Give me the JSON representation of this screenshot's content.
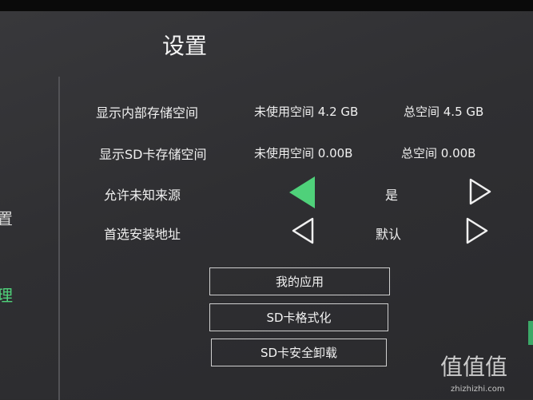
{
  "page": {
    "title": "设置"
  },
  "sidebar": {
    "partial_a": "置",
    "partial_b": "理"
  },
  "storage": {
    "internal": {
      "label": "显示内部存储空间",
      "free": "未使用空间 4.2 GB",
      "total": "总空间 4.5 GB"
    },
    "sd": {
      "label": "显示SD卡存储空间",
      "free": "未使用空间 0.00B",
      "total": "总空间 0.00B"
    }
  },
  "options": {
    "unknown_sources": {
      "label": "允许未知来源",
      "value": "是"
    },
    "install_location": {
      "label": "首选安装地址",
      "value": "默认"
    }
  },
  "buttons": {
    "my_apps": "我的应用",
    "sd_format": "SD卡格式化",
    "sd_unmount": "SD卡安全卸载"
  },
  "watermark": {
    "logo": "值值值",
    "url": "zhizhizhi.com"
  },
  "colors": {
    "accent": "#4fd17a",
    "text": "#f0f0f0",
    "background": "#2f2f32"
  }
}
